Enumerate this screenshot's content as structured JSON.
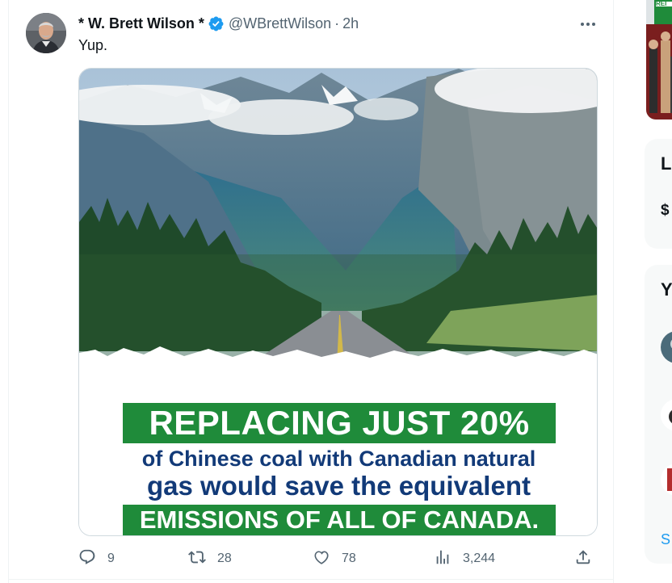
{
  "tweet": {
    "author_name": "* W. Brett Wilson *",
    "author_handle": "@WBrettWilson",
    "separator": "·",
    "timestamp": "2h",
    "text": "Yup.",
    "more_label": "···",
    "image": {
      "headline": "REPLACING JUST 20%",
      "line2": "of Chinese coal with Canadian natural",
      "line3": "gas would save the equivalent",
      "footer": "EMISSIONS OF ALL OF CANADA."
    },
    "stats": {
      "replies": "9",
      "retweets": "28",
      "likes": "78",
      "views": "3,244"
    }
  },
  "sidebar": {
    "card1_heading_fragment": "L",
    "card1_line_fragment": "$",
    "card2_heading_fragment": "Y",
    "card2_link_fragment": "S",
    "thumbnail_text_fragment": "REI"
  },
  "colors": {
    "accent": "#1d9bf0",
    "banner_green": "#1f8b3a",
    "banner_navy": "#123a78",
    "text_primary": "#0f1419",
    "text_secondary": "#536471",
    "border": "#cfd9de"
  },
  "icons": [
    "verified-icon",
    "more-icon",
    "reply-icon",
    "retweet-icon",
    "like-icon",
    "views-icon",
    "share-icon"
  ]
}
